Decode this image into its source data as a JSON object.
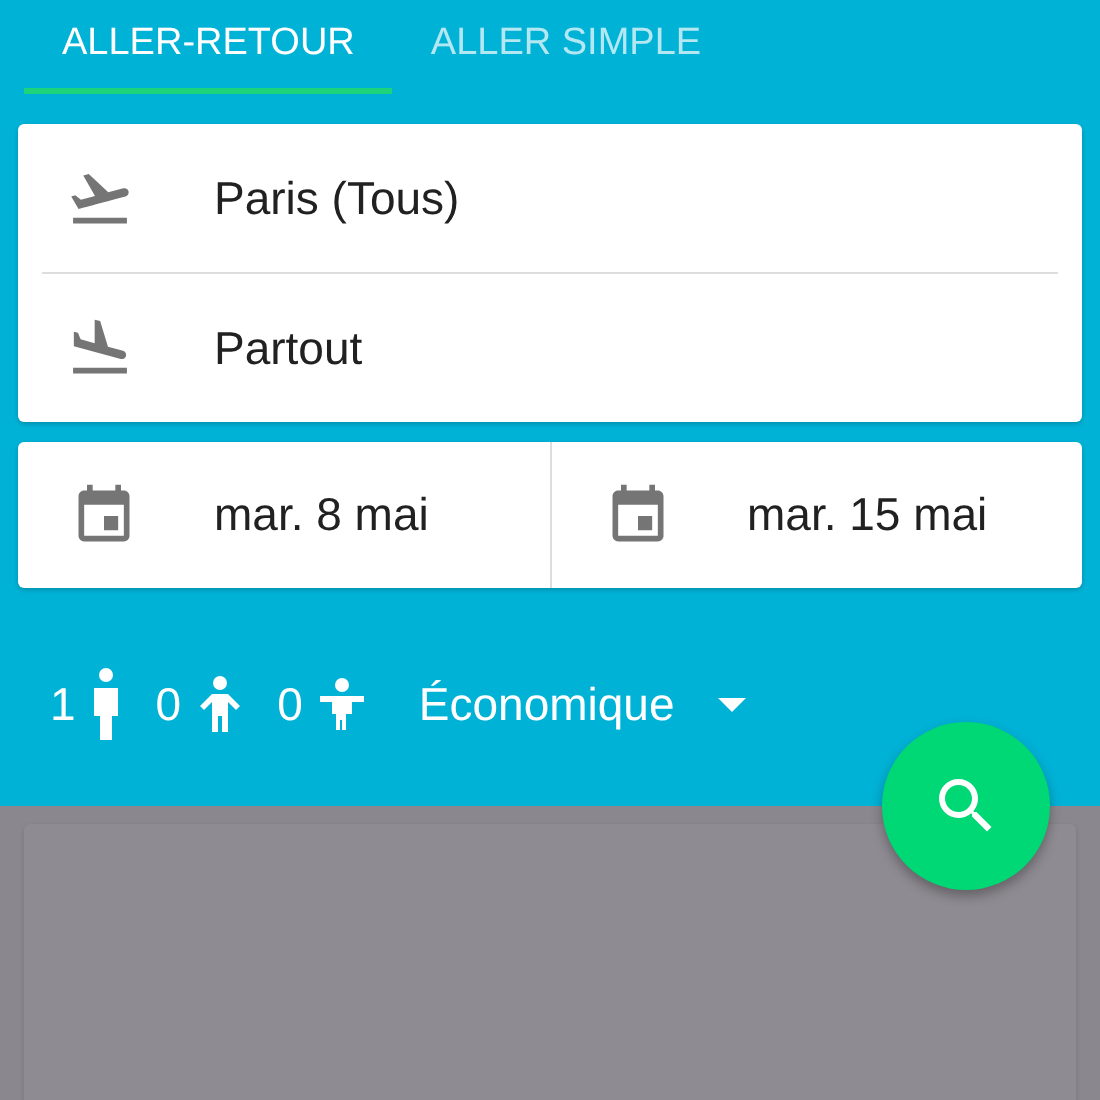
{
  "tabs": [
    {
      "label": "ALLER-RETOUR",
      "selected": true
    },
    {
      "label": "ALLER SIMPLE",
      "selected": false
    }
  ],
  "route": [
    {
      "kind": "departure",
      "value": "Paris (Tous)"
    },
    {
      "kind": "arrival",
      "value": "Partout"
    }
  ],
  "dates": [
    {
      "value": "mar. 8 mai"
    },
    {
      "value": "mar. 15 mai"
    }
  ],
  "passengers": [
    {
      "kind": "adult",
      "count": "1"
    },
    {
      "kind": "child",
      "count": "0"
    },
    {
      "kind": "infant",
      "count": "0"
    }
  ],
  "cabin_class": "Économique"
}
